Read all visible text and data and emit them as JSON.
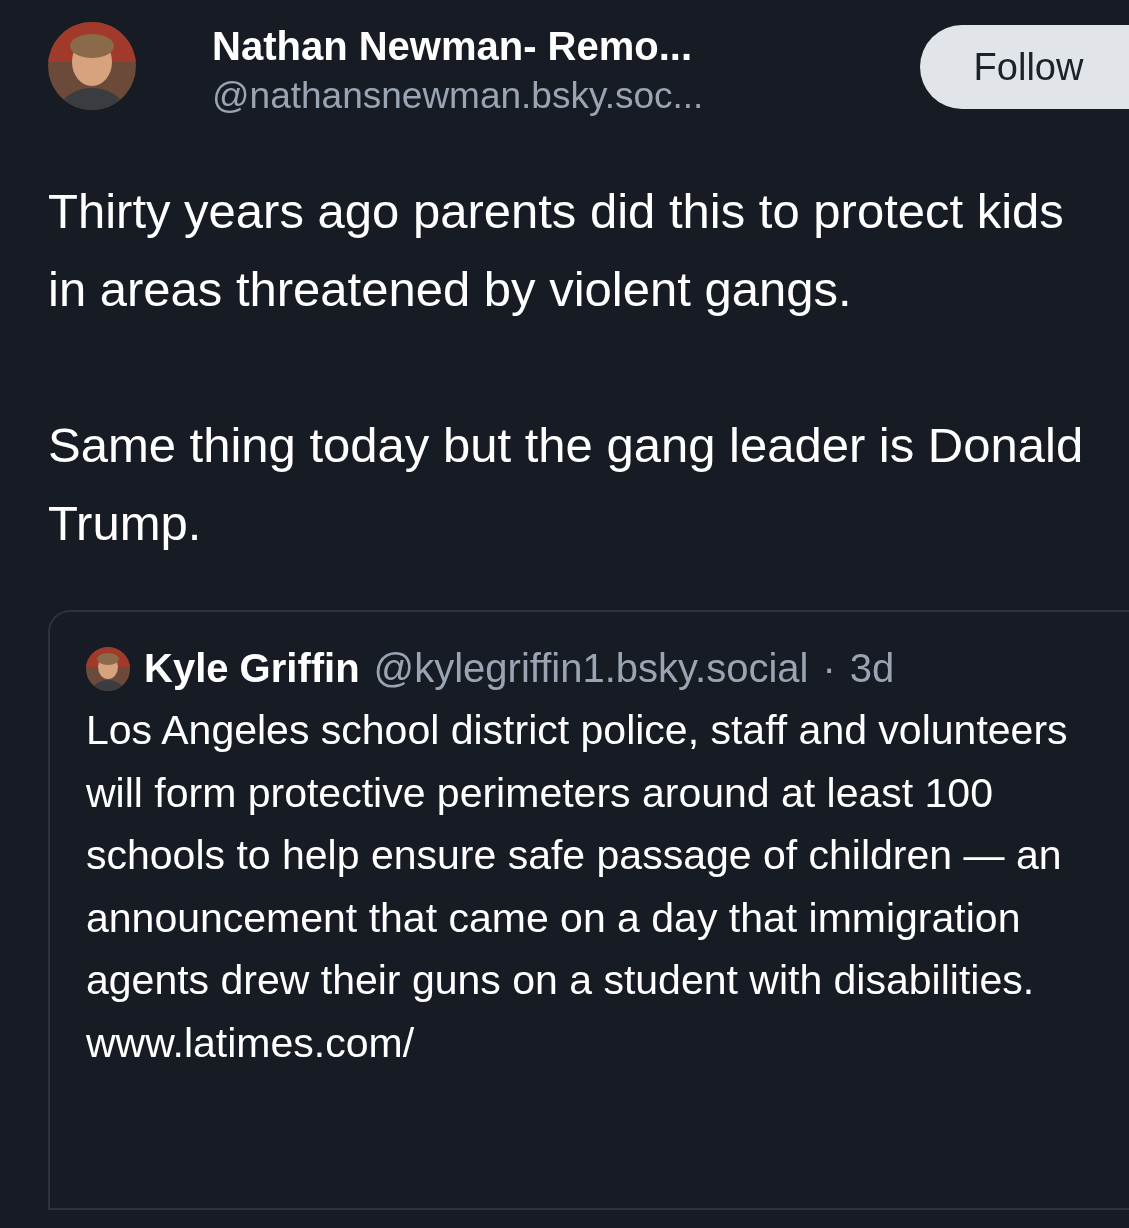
{
  "post": {
    "author": {
      "name": "Nathan Newman- Remo...",
      "handle": "@nathansnewman.bsky.soc..."
    },
    "follow_button": "Follow",
    "paragraphs": [
      "Thirty years ago parents did this to protect kids in areas threatened by violent gangs.",
      "Same thing today but the gang leader is Donald Trump."
    ],
    "quote": {
      "name": "Kyle Griffin",
      "handle": "@kylegriffin1.bsky.social",
      "separator": "·",
      "time": "3d",
      "text": "Los Angeles school district police, staff and volunteers will form protective perimeters around at least 100 schools to help ensure safe passage of children — an announcement that came on a day that immigration agents drew their guns on a student with disabilities. www.latimes.com/"
    }
  }
}
